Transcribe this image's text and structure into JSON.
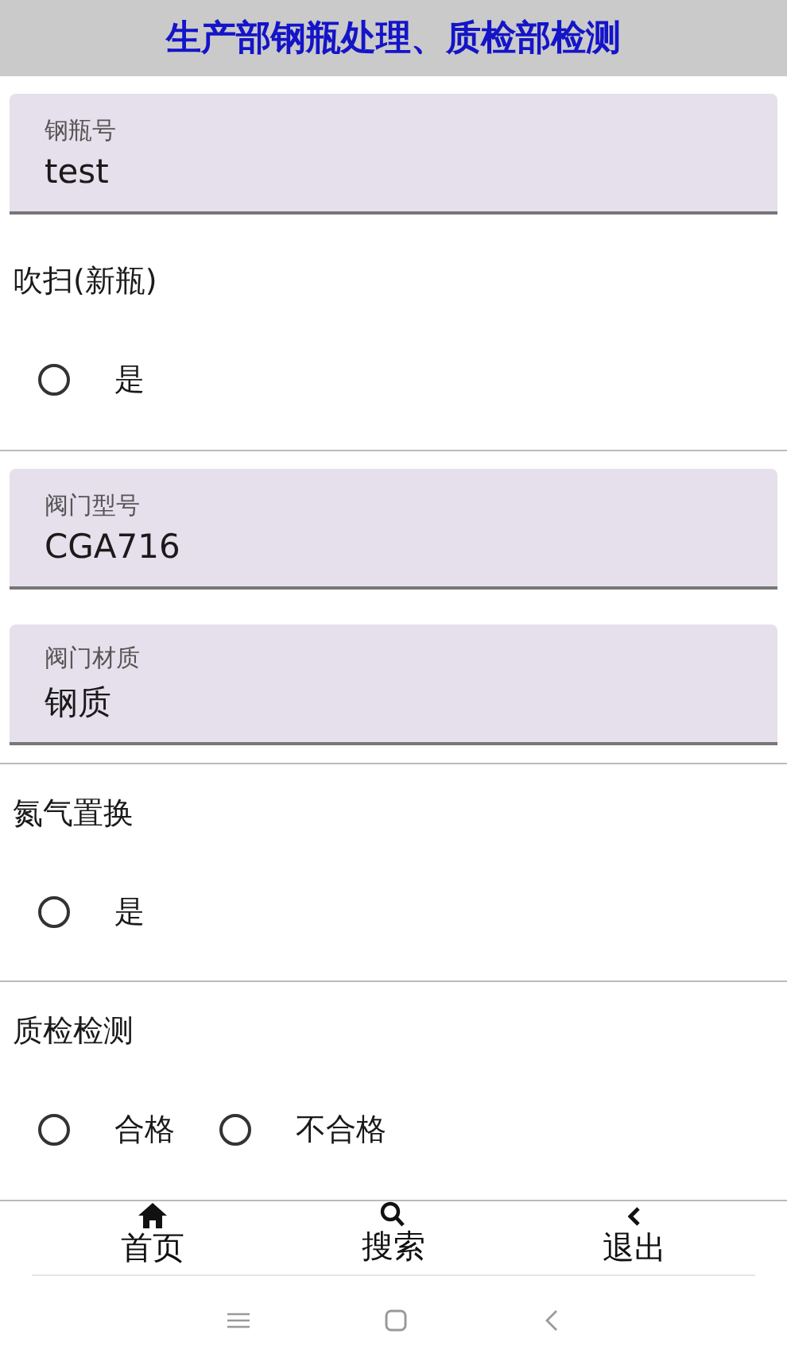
{
  "header": {
    "title": "生产部钢瓶处理、质检部检测"
  },
  "items": [
    {
      "kind": "field",
      "label": "钢瓶号",
      "value": "test"
    },
    {
      "kind": "radio_group",
      "label": "吹扫(新瓶)",
      "options": [
        {
          "label": "是",
          "selected": false
        }
      ]
    },
    {
      "kind": "field",
      "label": "阀门型号",
      "value": "CGA716"
    },
    {
      "kind": "field",
      "label": "阀门材质",
      "value": "钢质"
    },
    {
      "kind": "radio_group",
      "label": "氮气置换",
      "options": [
        {
          "label": "是",
          "selected": false
        }
      ]
    },
    {
      "kind": "radio_group",
      "label": "质检检测",
      "options": [
        {
          "label": "合格",
          "selected": false
        },
        {
          "label": "不合格",
          "selected": false
        }
      ]
    }
  ],
  "bottom_nav": [
    {
      "kind": "home",
      "label": "首页"
    },
    {
      "kind": "search",
      "label": "搜索"
    },
    {
      "kind": "back",
      "label": "退出"
    }
  ]
}
